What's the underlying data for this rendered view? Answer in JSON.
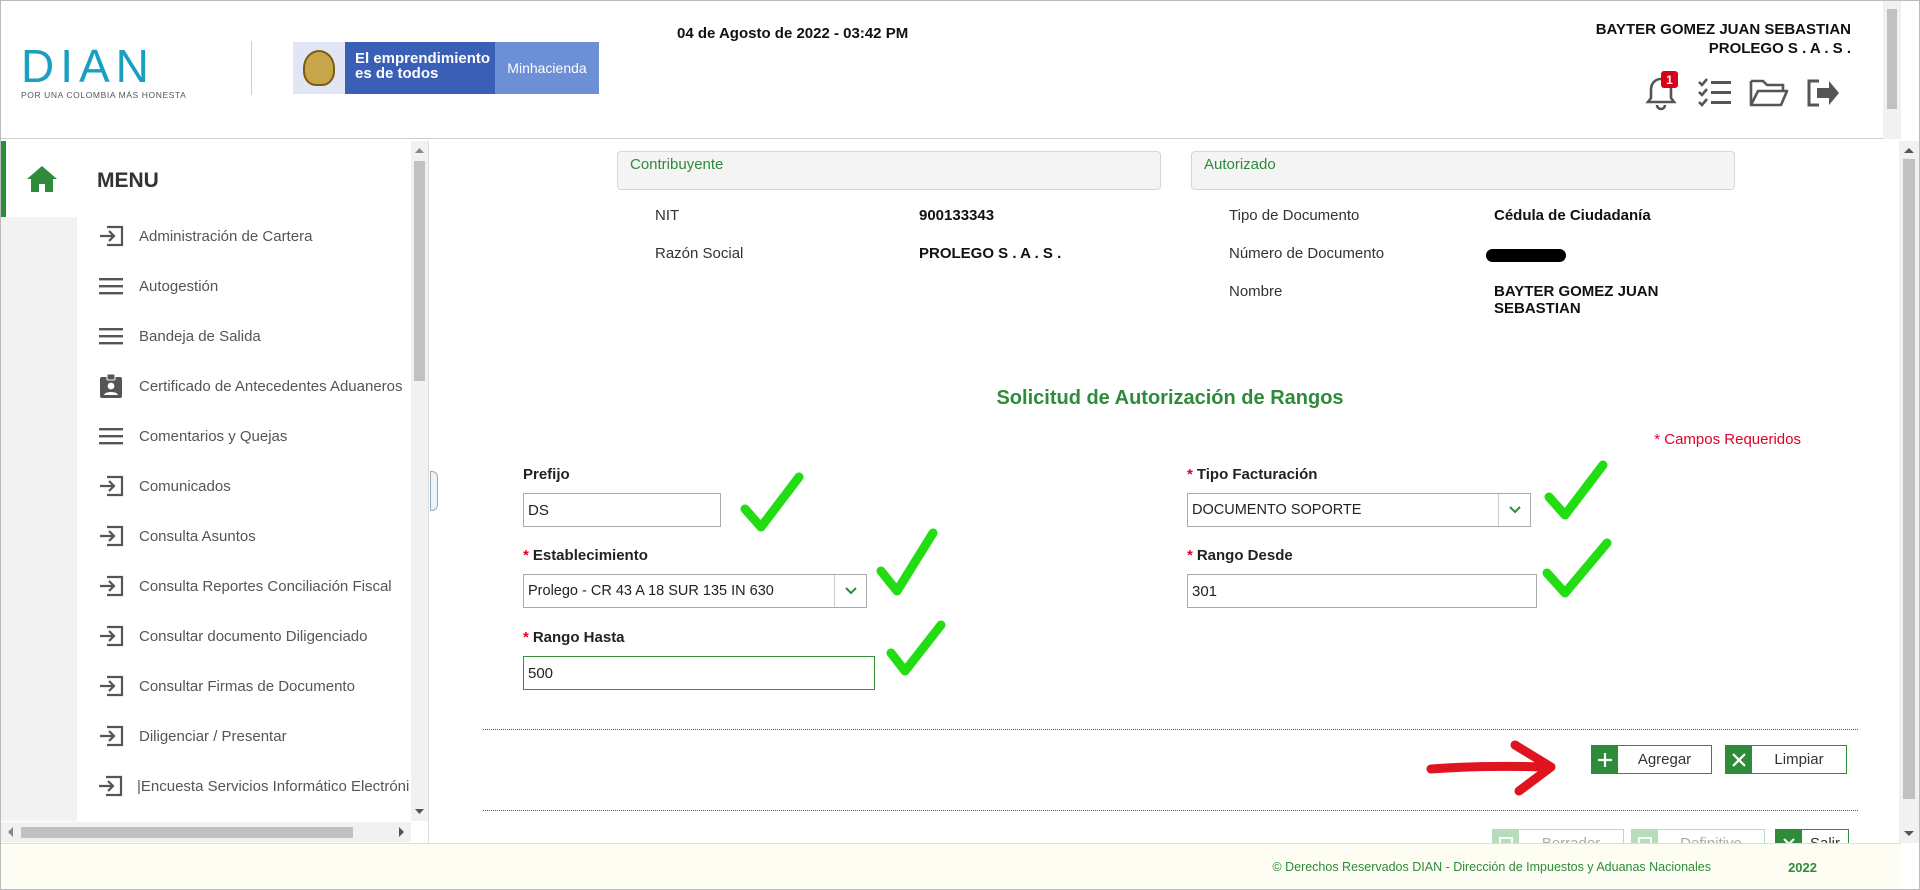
{
  "header": {
    "logo_text": "DIAN",
    "logo_tagline": "POR UNA COLOMBIA MÁS HONESTA",
    "banner_line1": "El emprendimiento",
    "banner_line2": "es de todos",
    "banner_ministry": "Minhacienda",
    "datetime": "04 de Agosto de 2022 - 03:42 PM",
    "user_name": "BAYTER GOMEZ JUAN SEBASTIAN",
    "company": "PROLEGO S . A . S .",
    "notifications_count": "1",
    "icons": [
      "bell-icon",
      "checklist-icon",
      "folder-open-icon",
      "logout-icon"
    ]
  },
  "sidebar": {
    "title": "MENU",
    "home_icon": "home-icon",
    "items": [
      {
        "label": "Administración de Cartera",
        "icon": "login-arrow-icon"
      },
      {
        "label": "Autogestión",
        "icon": "hamburger-icon"
      },
      {
        "label": "Bandeja de Salida",
        "icon": "hamburger-icon"
      },
      {
        "label": "Certificado de Antecedentes Aduaneros",
        "icon": "id-badge-icon"
      },
      {
        "label": "Comentarios y Quejas",
        "icon": "hamburger-icon"
      },
      {
        "label": "Comunicados",
        "icon": "login-arrow-icon"
      },
      {
        "label": "Consulta Asuntos",
        "icon": "login-arrow-icon"
      },
      {
        "label": "Consulta Reportes Conciliación Fiscal",
        "icon": "login-arrow-icon"
      },
      {
        "label": "Consultar documento Diligenciado",
        "icon": "login-arrow-icon"
      },
      {
        "label": "Consultar Firmas de Documento",
        "icon": "login-arrow-icon"
      },
      {
        "label": "Diligenciar / Presentar",
        "icon": "login-arrow-icon"
      },
      {
        "label": "|Encuesta Servicios Informático Electróni",
        "icon": "login-arrow-icon"
      }
    ]
  },
  "contribuyente": {
    "heading": "Contribuyente",
    "nit_label": "NIT",
    "nit_value": "900133343",
    "razon_label": "Razón Social",
    "razon_value": "PROLEGO S . A . S ."
  },
  "autorizado": {
    "heading": "Autorizado",
    "tipo_label": "Tipo de Documento",
    "tipo_value": "Cédula de Ciudadanía",
    "numero_label": "Número de Documento",
    "nombre_label": "Nombre",
    "nombre_line1": "BAYTER GOMEZ JUAN",
    "nombre_line2": "SEBASTIAN"
  },
  "form": {
    "title": "Solicitud de Autorización de Rangos",
    "required_note": "* Campos Requeridos",
    "required_mark": "*",
    "prefijo_label": "Prefijo",
    "prefijo_value": "DS",
    "tipo_facturacion_label": "Tipo Facturación",
    "tipo_facturacion_value": "DOCUMENTO SOPORTE",
    "establecimiento_label": "Establecimiento",
    "establecimiento_value": "Prolego - CR 43 A 18 SUR 135 IN 630",
    "rango_desde_label": "Rango Desde",
    "rango_desde_value": "301",
    "rango_hasta_label": "Rango Hasta",
    "rango_hasta_value": "500"
  },
  "actions": {
    "agregar": "Agregar",
    "limpiar": "Limpiar",
    "borrador": "Borrador",
    "definitivo": "Definitivo",
    "salir": "Salir"
  },
  "footer": {
    "copyright": "© Derechos Reservados DIAN - Dirección de Impuestos y Aduanas Nacionales",
    "year": "2022"
  },
  "colors": {
    "brand_green": "#2e8b3a",
    "dian_blue": "#1a9fc0",
    "required_red": "#e0002a",
    "annotation_green": "#22dd11",
    "annotation_red": "#e0141e"
  }
}
